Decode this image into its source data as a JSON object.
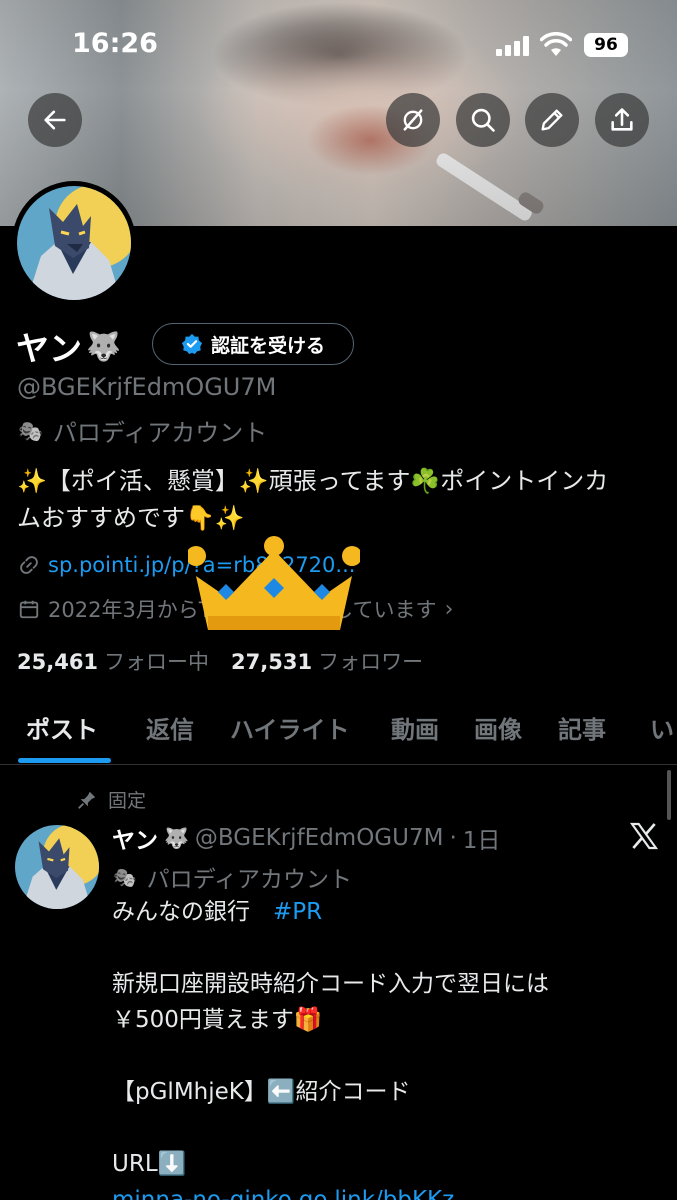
{
  "status_bar": {
    "time": "16:26",
    "battery": "96"
  },
  "header": {
    "back_icon": "arrow-left-icon",
    "actions": [
      "grok-icon",
      "search-icon",
      "edit-icon",
      "share-icon"
    ]
  },
  "profile": {
    "name": "ヤン",
    "name_emoji": "🐺",
    "verify_button": "認証を受ける",
    "handle": "@BGEKrjfEdmOGU7M",
    "label_icon": "🎭",
    "label": "パロディアカウント",
    "bio_line1": "✨【ポイ活、懸賞】✨頑張ってます☘️ポイントインカ",
    "bio_line2": "ムおすすめです👇✨",
    "link": "sp.pointi.jp/p/?a=rb882720...",
    "joined": "2022年3月からTwitterを利用しています",
    "following_count": "25,461",
    "following_label": "フォロー中",
    "followers_count": "27,531",
    "followers_label": "フォロワー"
  },
  "tabs": [
    "ポスト",
    "返信",
    "ハイライト",
    "動画",
    "画像",
    "記事",
    "い"
  ],
  "active_tab": "ポスト",
  "post": {
    "pinned_label": "固定",
    "author_name": "ヤン",
    "author_emoji": "🐺",
    "author_handle": "@BGEKrjfEdmOGU7M",
    "time": "1日",
    "author_label": "パロディアカウント",
    "line1_text": "みんなの銀行　",
    "line1_hashtag": "#PR",
    "line2": "新規口座開設時紹介コード入力で翌日には",
    "line3": "￥500円貰えます🎁",
    "line4": "【pGlMhjeK】⬅️紹介コード",
    "line5": "URL⬇️",
    "line6": "minna-no-ginko.go.link/bbKKz"
  }
}
